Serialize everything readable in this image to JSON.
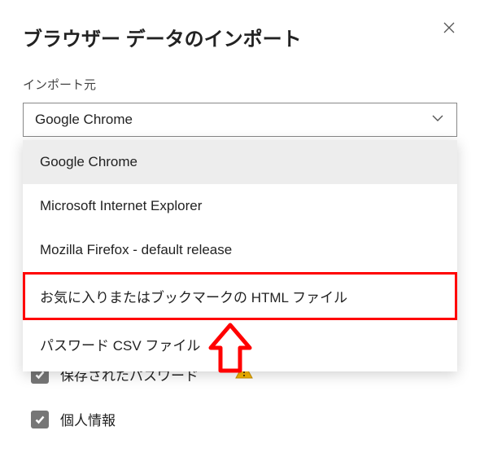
{
  "dialog": {
    "title": "ブラウザー データのインポート",
    "close_label": "閉じる"
  },
  "source": {
    "label": "インポート元",
    "selected_value": "Google Chrome",
    "options": [
      {
        "label": "Google Chrome",
        "selected": true
      },
      {
        "label": "Microsoft Internet Explorer",
        "selected": false
      },
      {
        "label": "Mozilla Firefox - default release",
        "selected": false
      },
      {
        "label": "お気に入りまたはブックマークの HTML ファイル",
        "selected": false,
        "highlighted": true
      },
      {
        "label": "パスワード CSV ファイル",
        "selected": false
      }
    ]
  },
  "checkboxes": {
    "saved_passwords": {
      "label": "保存されたパスワード",
      "checked": true,
      "warning": true
    },
    "personal_info": {
      "label": "個人情報",
      "checked": true
    }
  },
  "annotation": {
    "highlight_color": "#ff0000",
    "arrow_color": "#ff0000"
  }
}
